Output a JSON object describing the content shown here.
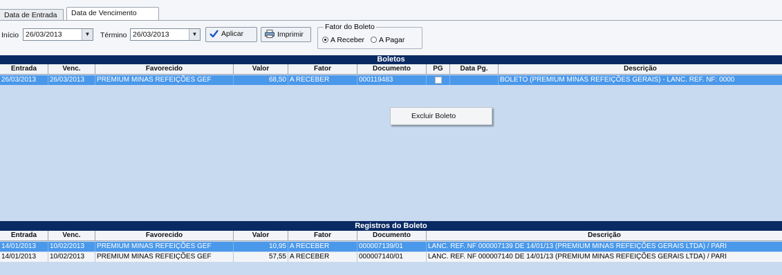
{
  "tabs": [
    {
      "label": "Data de Entrada"
    },
    {
      "label": "Data de Vencimento"
    }
  ],
  "filter": {
    "inicio_label": "Início",
    "inicio_value": "26/03/2013",
    "termino_label": "Término",
    "termino_value": "26/03/2013",
    "aplicar_label": "Aplicar",
    "imprimir_label": "Imprimir",
    "fator_legend": "Fator do Boleto",
    "fator_options": [
      "A Receber",
      "A Pagar"
    ],
    "fator_selected": "A Receber"
  },
  "boletos": {
    "title": "Boletos",
    "headers": [
      "Entrada",
      "Venc.",
      "Favorecido",
      "Valor",
      "Fator",
      "Documento",
      "PG",
      "Data Pg.",
      "Descrição"
    ],
    "rows": [
      {
        "entrada": "26/03/2013",
        "venc": "26/03/2013",
        "favorecido": "PREMIUM MINAS REFEIÇÕES GEF",
        "valor": "68,50",
        "fator": "A RECEBER",
        "documento": "000119483",
        "pg": false,
        "data_pg": "",
        "descricao": "BOLETO (PREMIUM MINAS REFEIÇÕES GERAIS) - LANC. REF. NF: 0000"
      }
    ]
  },
  "context_menu": {
    "items": [
      "Excluir Boleto"
    ]
  },
  "registros": {
    "title": "Registros do Boleto",
    "headers": [
      "Entrada",
      "Venc.",
      "Favorecido",
      "Valor",
      "Fator",
      "Documento",
      "Descrição"
    ],
    "rows": [
      {
        "entrada": "14/01/2013",
        "venc": "10/02/2013",
        "favorecido": "PREMIUM MINAS REFEIÇÕES GEF",
        "valor": "10,95",
        "fator": "A RECEBER",
        "documento": "000007139/01",
        "descricao": "LANC. REF. NF 000007139 DE 14/01/13 (PREMIUM MINAS REFEIÇÕES GERAIS LTDA) / PARI"
      },
      {
        "entrada": "14/01/2013",
        "venc": "10/02/2013",
        "favorecido": "PREMIUM MINAS REFEIÇÕES GEF",
        "valor": "57,55",
        "fator": "A RECEBER",
        "documento": "000007140/01",
        "descricao": "LANC. REF. NF 000007140 DE 14/01/13 (PREMIUM MINAS REFEIÇÕES GERAIS LTDA) / PARI"
      }
    ]
  },
  "colors": {
    "title_bar": "#0a2a63",
    "grid_bg": "#c8daf0",
    "selected_row": "#4a98ea"
  }
}
